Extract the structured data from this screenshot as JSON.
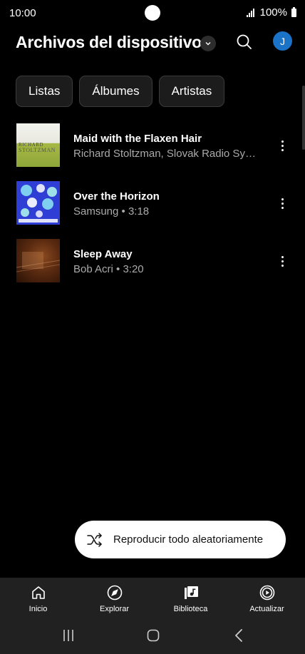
{
  "status_bar": {
    "time": "10:00",
    "battery": "100%"
  },
  "header": {
    "title": "Archivos del dispositivo",
    "avatar_initial": "J"
  },
  "chips": [
    {
      "label": "Listas"
    },
    {
      "label": "Álbumes"
    },
    {
      "label": "Artistas"
    }
  ],
  "songs": [
    {
      "title": "Maid with the Flaxen Hair",
      "subtitle": "Richard Stoltzman, Slovak Radio Symphony Orchestra",
      "cover_line1": "RICHARD",
      "cover_line2": "STOLTZMAN"
    },
    {
      "title": "Over the Horizon",
      "subtitle": "Samsung • 3:18"
    },
    {
      "title": "Sleep Away",
      "subtitle": "Bob Acri • 3:20"
    }
  ],
  "shuffle": {
    "label": "Reproducir todo aleatoriamente"
  },
  "bottom_nav": [
    {
      "label": "Inicio",
      "icon": "home-icon"
    },
    {
      "label": "Explorar",
      "icon": "compass-icon"
    },
    {
      "label": "Biblioteca",
      "icon": "library-icon"
    },
    {
      "label": "Actualizar",
      "icon": "play-circle-icon"
    }
  ],
  "colors": {
    "background": "#000000",
    "avatar": "#1a73c6",
    "nav_background": "#212121",
    "chip_background": "#1c1c1c"
  }
}
